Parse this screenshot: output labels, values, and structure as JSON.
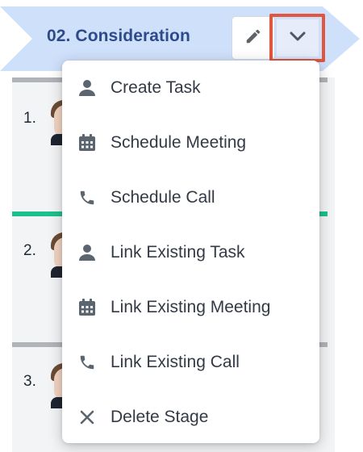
{
  "stage": {
    "title": "02. Consideration",
    "chevron_color": "#cfe0fb",
    "accent": "#e0563e"
  },
  "icons": {
    "edit": "pencil-icon",
    "dropdown": "chevron-down-icon"
  },
  "cards": [
    {
      "number": "1.",
      "bar_color": "#b0b3b8"
    },
    {
      "number": "2.",
      "bar_color": "#1dbf8d"
    },
    {
      "number": "3.",
      "bar_color": "#b0b3b8"
    }
  ],
  "menu": {
    "items": [
      {
        "label": "Create Task",
        "icon": "person-icon"
      },
      {
        "label": "Schedule Meeting",
        "icon": "calendar-icon"
      },
      {
        "label": "Schedule Call",
        "icon": "phone-icon"
      },
      {
        "label": "Link Existing Task",
        "icon": "person-icon"
      },
      {
        "label": "Link Existing Meeting",
        "icon": "calendar-icon"
      },
      {
        "label": "Link Existing Call",
        "icon": "phone-icon"
      },
      {
        "label": "Delete Stage",
        "icon": "close-icon"
      }
    ]
  }
}
